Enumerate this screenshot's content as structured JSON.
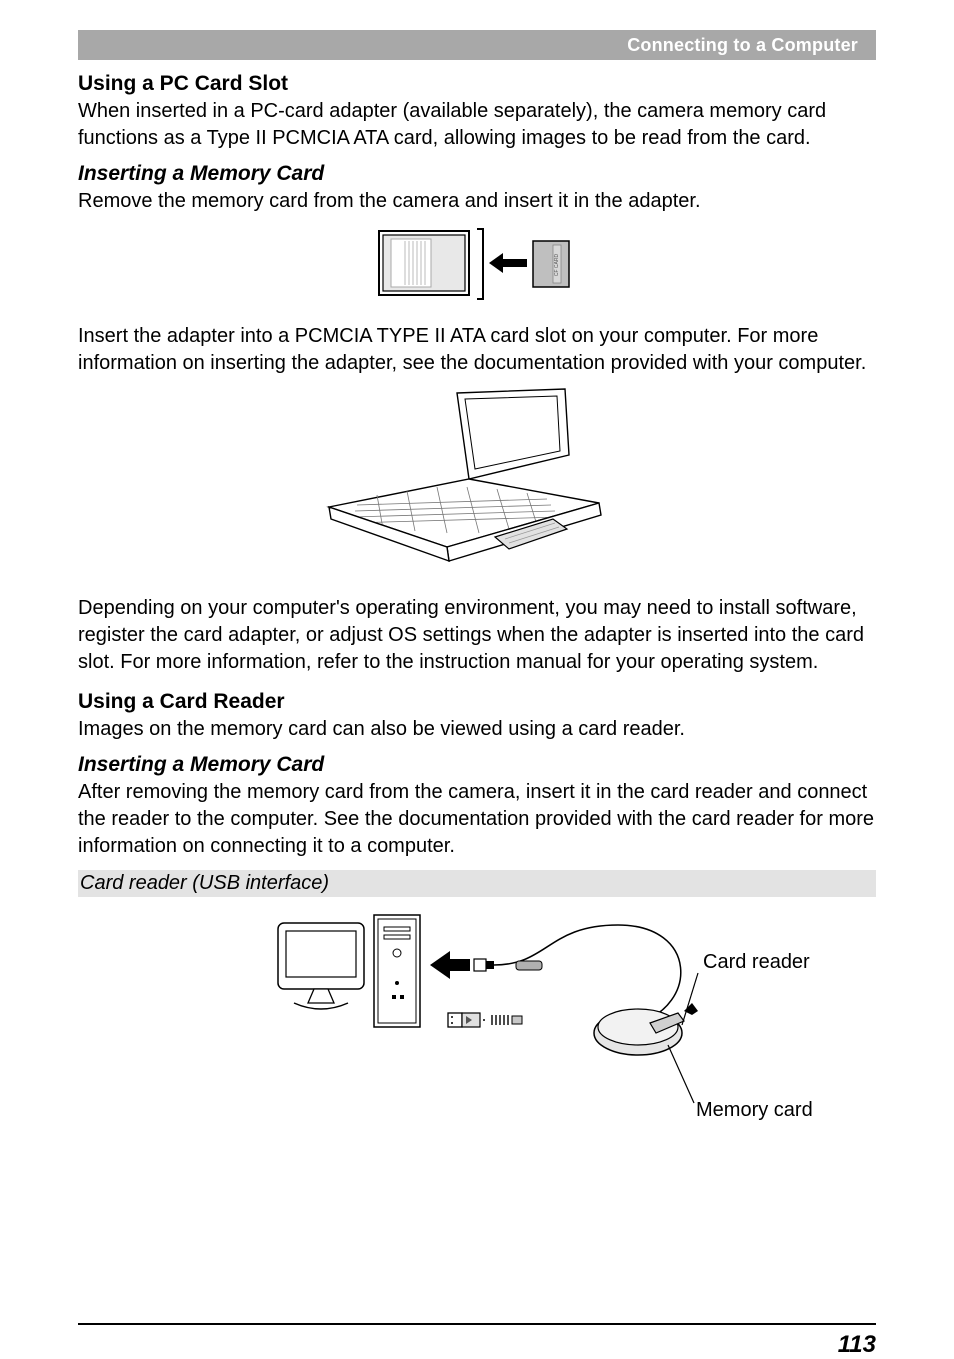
{
  "header": {
    "section_title": "Connecting to a Computer"
  },
  "section1": {
    "heading": "Using a PC Card Slot",
    "para1": "When inserted in a PC-card adapter (available separately), the camera memory card functions as a Type II PCMCIA ATA card, allowing images to be read from the card.",
    "sub_heading": "Inserting a Memory Card",
    "para2": "Remove the memory card from the camera and insert it in the adapter.",
    "fig1_card_label": "CF CARD",
    "para3": "Insert the adapter into a PCMCIA TYPE II ATA card slot on your computer. For more information on inserting the adapter, see the documentation provided with your computer.",
    "para4": "Depending on your computer's operating environment, you may need to install software, register the card adapter, or adjust OS settings when the adapter is inserted into the card slot. For more information, refer to the instruction manual for your operating system."
  },
  "section2": {
    "heading": "Using a Card Reader",
    "para1": "Images on the memory card can also be viewed using a card reader.",
    "sub_heading": "Inserting a Memory Card",
    "para2": "After removing the memory card from the camera, insert it in the card reader and connect the reader to the computer. See the documentation provided with the card reader for more information on connecting it to a computer.",
    "band_label": "Card reader (USB interface)",
    "label_reader": "Card reader",
    "label_memcard": "Memory card"
  },
  "footer": {
    "page_number": "113"
  }
}
